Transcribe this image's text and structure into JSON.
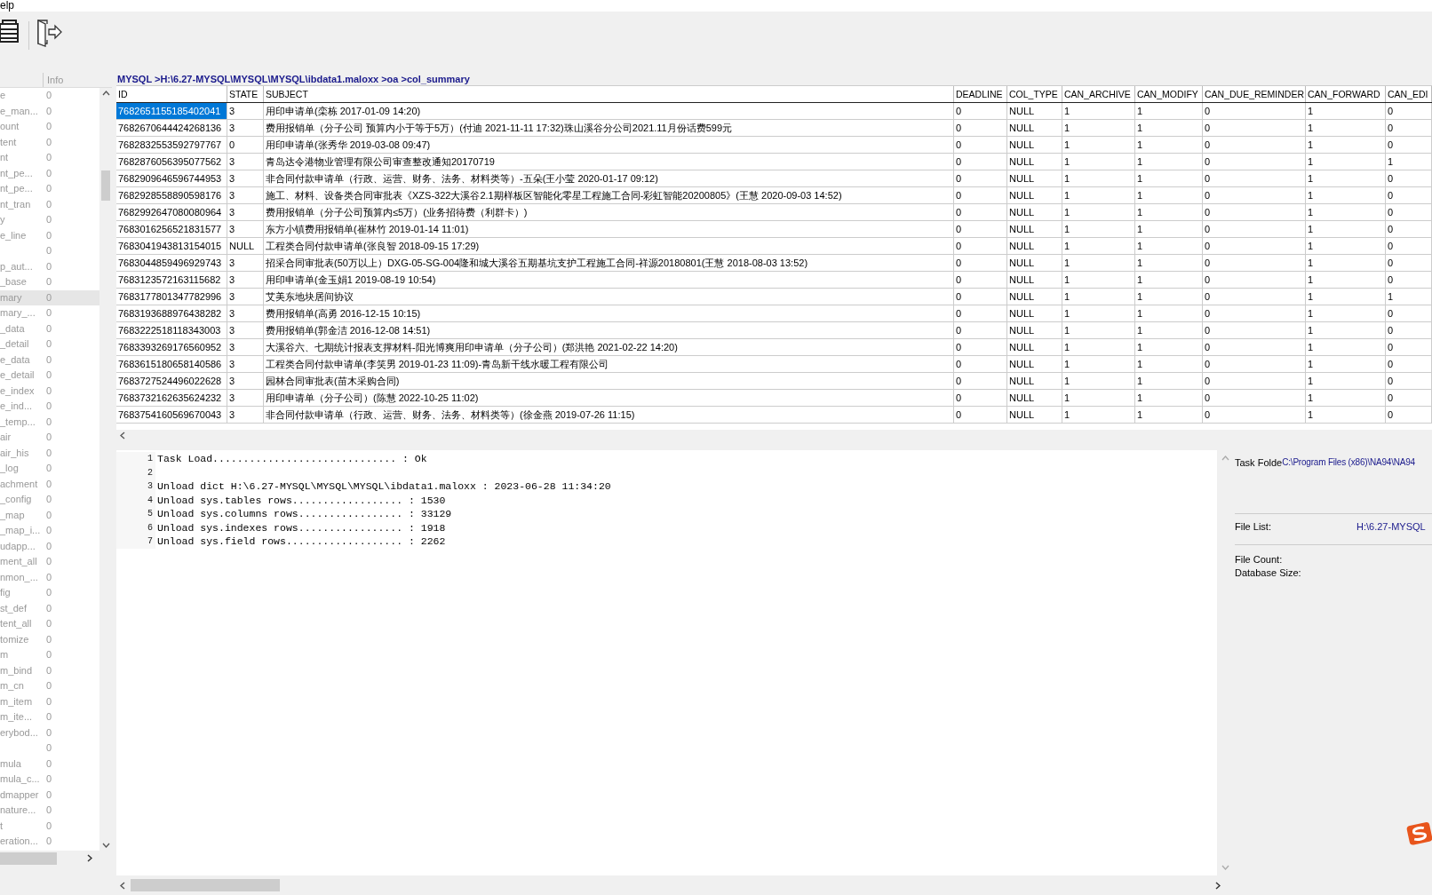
{
  "menu": {
    "items": [
      "elp"
    ]
  },
  "sidebar": {
    "header": "Info",
    "items": [
      {
        "name": "e",
        "info": "0",
        "selected": false
      },
      {
        "name": "e_man...",
        "info": "0",
        "selected": false
      },
      {
        "name": "ount",
        "info": "0",
        "selected": false
      },
      {
        "name": "tent",
        "info": "0",
        "selected": false
      },
      {
        "name": "nt",
        "info": "0",
        "selected": false
      },
      {
        "name": "nt_pe...",
        "info": "0",
        "selected": false
      },
      {
        "name": "nt_pe...",
        "info": "0",
        "selected": false
      },
      {
        "name": "nt_tran",
        "info": "0",
        "selected": false
      },
      {
        "name": "y",
        "info": "0",
        "selected": false
      },
      {
        "name": "e_line",
        "info": "0",
        "selected": false
      },
      {
        "info": "0",
        "selected": false
      },
      {
        "name": "p_aut...",
        "info": "0",
        "selected": false
      },
      {
        "name": "_base",
        "info": "0",
        "selected": false
      },
      {
        "name": "mary",
        "info": "0",
        "selected": true
      },
      {
        "name": "mary_...",
        "info": "0",
        "selected": false
      },
      {
        "name": "_data",
        "info": "0",
        "selected": false
      },
      {
        "name": "_detail",
        "info": "0",
        "selected": false
      },
      {
        "name": "e_data",
        "info": "0",
        "selected": false
      },
      {
        "name": "e_detail",
        "info": "0",
        "selected": false
      },
      {
        "name": "e_index",
        "info": "0",
        "selected": false
      },
      {
        "name": "e_ind...",
        "info": "0",
        "selected": false
      },
      {
        "name": "_temp...",
        "info": "0",
        "selected": false
      },
      {
        "name": "air",
        "info": "0",
        "selected": false
      },
      {
        "name": "air_his",
        "info": "0",
        "selected": false
      },
      {
        "name": "_log",
        "info": "0",
        "selected": false
      },
      {
        "name": "achment",
        "info": "0",
        "selected": false
      },
      {
        "name": "_config",
        "info": "0",
        "selected": false
      },
      {
        "name": "_map",
        "info": "0",
        "selected": false
      },
      {
        "name": "_map_i...",
        "info": "0",
        "selected": false
      },
      {
        "name": "udapp...",
        "info": "0",
        "selected": false
      },
      {
        "name": "ment_all",
        "info": "0",
        "selected": false
      },
      {
        "name": "nmon_...",
        "info": "0",
        "selected": false
      },
      {
        "name": "fig",
        "info": "0",
        "selected": false
      },
      {
        "name": "st_def",
        "info": "0",
        "selected": false
      },
      {
        "name": "tent_all",
        "info": "0",
        "selected": false
      },
      {
        "name": "tomize",
        "info": "0",
        "selected": false
      },
      {
        "name": "m",
        "info": "0",
        "selected": false
      },
      {
        "name": "m_bind",
        "info": "0",
        "selected": false
      },
      {
        "name": "m_cn",
        "info": "0",
        "selected": false
      },
      {
        "name": "m_item",
        "info": "0",
        "selected": false
      },
      {
        "name": "m_ite...",
        "info": "0",
        "selected": false
      },
      {
        "name": "erybod...",
        "info": "0",
        "selected": false
      },
      {
        "info": "0",
        "selected": false
      },
      {
        "name": "mula",
        "info": "0",
        "selected": false
      },
      {
        "name": "mula_c...",
        "info": "0",
        "selected": false
      },
      {
        "name": "dmapper",
        "info": "0",
        "selected": false
      },
      {
        "name": "nature...",
        "info": "0",
        "selected": false
      },
      {
        "name": "t",
        "info": "0",
        "selected": false
      },
      {
        "name": "eration...",
        "info": "0",
        "selected": false
      }
    ]
  },
  "table": {
    "path": "MYSQL >H:\\6.27-MYSQL\\MYSQL\\MYSQL\\ibdata1.maloxx >oa >col_summary",
    "columns": [
      "ID",
      "STATE",
      "SUBJECT",
      "DEADLINE",
      "COL_TYPE",
      "CAN_ARCHIVE",
      "CAN_MODIFY",
      "CAN_DUE_REMINDER",
      "CAN_FORWARD",
      "CAN_EDI"
    ],
    "rows": [
      {
        "selected": true,
        "cells": [
          "7682651155185402041",
          "3",
          "用印申请单(栾栋 2017-01-09 14:20)",
          "0",
          "NULL",
          "1",
          "1",
          "0",
          "1",
          "0"
        ]
      },
      {
        "selected": false,
        "cells": [
          "7682670644424268136",
          "3",
          "费用报销单（分子公司 预算内小于等于5万）(付迪 2021-11-11 17:32)珠山溪谷分公司2021.11月份话费599元",
          "0",
          "NULL",
          "1",
          "1",
          "0",
          "1",
          "0"
        ]
      },
      {
        "selected": false,
        "cells": [
          "7682832553592797767",
          "0",
          "用印申请单(张秀华 2019-03-08 09:47)",
          "0",
          "NULL",
          "1",
          "1",
          "0",
          "1",
          "0"
        ]
      },
      {
        "selected": false,
        "cells": [
          "7682876056395077562",
          "3",
          "青岛达令港物业管理有限公司审查整改通知20170719",
          "0",
          "NULL",
          "1",
          "1",
          "0",
          "1",
          "1"
        ]
      },
      {
        "selected": false,
        "cells": [
          "7682909646596744953",
          "3",
          "非合同付款申请单（行政、运营、财务、法务、材料类等）-五朵(王小莹 2020-01-17 09:12)",
          "0",
          "NULL",
          "1",
          "1",
          "0",
          "1",
          "0"
        ]
      },
      {
        "selected": false,
        "cells": [
          "7682928558890598176",
          "3",
          "施工、材料、设备类合同审批表《XZS-322大溪谷2.1期样板区智能化零星工程施工合同-彩虹智能20200805》(王慧 2020-09-03 14:52)",
          "0",
          "NULL",
          "1",
          "1",
          "0",
          "1",
          "0"
        ]
      },
      {
        "selected": false,
        "cells": [
          "7682992647080080964",
          "3",
          "费用报销单（分子公司预算内≤5万）(业务招待费（利群卡）)",
          "0",
          "NULL",
          "1",
          "1",
          "0",
          "1",
          "0"
        ]
      },
      {
        "selected": false,
        "cells": [
          "7683016256521831577",
          "3",
          "东方小镇费用报销单(崔林竹 2019-01-14 11:01)",
          "0",
          "NULL",
          "1",
          "1",
          "0",
          "1",
          "0"
        ]
      },
      {
        "selected": false,
        "cells": [
          "7683041943813154015",
          "NULL",
          "工程类合同付款申请单(张良智 2018-09-15 17:29)",
          "0",
          "NULL",
          "1",
          "1",
          "0",
          "1",
          "0"
        ]
      },
      {
        "selected": false,
        "cells": [
          "7683044859496929743",
          "3",
          "招采合同审批表(50万以上）DXG-05-SG-004隆和城大溪谷五期基坑支护工程施工合同-祥源20180801(王慧 2018-08-03 13:52)",
          "0",
          "NULL",
          "1",
          "1",
          "0",
          "1",
          "0"
        ]
      },
      {
        "selected": false,
        "cells": [
          "7683123572163115682",
          "3",
          "用印申请单(金玉娟1 2019-08-19 10:54)",
          "0",
          "NULL",
          "1",
          "1",
          "0",
          "1",
          "0"
        ]
      },
      {
        "selected": false,
        "cells": [
          "7683177801347782996",
          "3",
          "艾美东地块居间协议",
          "0",
          "NULL",
          "1",
          "1",
          "0",
          "1",
          "1"
        ]
      },
      {
        "selected": false,
        "cells": [
          "7683193688976438282",
          "3",
          "费用报销单(高勇 2016-12-15 10:15)",
          "0",
          "NULL",
          "1",
          "1",
          "0",
          "1",
          "0"
        ]
      },
      {
        "selected": false,
        "cells": [
          "7683222518118343003",
          "3",
          "费用报销单(郭金洁 2016-12-08 14:51)",
          "0",
          "NULL",
          "1",
          "1",
          "0",
          "1",
          "0"
        ]
      },
      {
        "selected": false,
        "cells": [
          "7683393269176560952",
          "3",
          "大溪谷六、七期统计报表支撑材料-阳光博爽用印申请单（分子公司）(郑洪艳 2021-02-22 14:20)",
          "0",
          "NULL",
          "1",
          "1",
          "0",
          "1",
          "0"
        ]
      },
      {
        "selected": false,
        "cells": [
          "7683615180658140586",
          "3",
          "工程类合同付款申请单(李笑男 2019-01-23 11:09)-青岛新干线水暖工程有限公司",
          "0",
          "NULL",
          "1",
          "1",
          "0",
          "1",
          "0"
        ]
      },
      {
        "selected": false,
        "cells": [
          "7683727524496022628",
          "3",
          "园林合同审批表(苗木采购合同)",
          "0",
          "NULL",
          "1",
          "1",
          "0",
          "1",
          "0"
        ]
      },
      {
        "selected": false,
        "cells": [
          "7683732162635624232",
          "3",
          "用印申请单（分子公司）(陈慧 2022-10-25 11:02)",
          "0",
          "NULL",
          "1",
          "1",
          "0",
          "1",
          "0"
        ]
      },
      {
        "selected": false,
        "cells": [
          "7683754160569670043",
          "3",
          "非合同付款申请单（行政、运营、财务、法务、材料类等）(徐金燕 2019-07-26 11:15)",
          "0",
          "NULL",
          "1",
          "1",
          "0",
          "1",
          "0"
        ]
      }
    ]
  },
  "log": {
    "lines": [
      {
        "number": "1",
        "text": "Task Load.............................. : Ok"
      },
      {
        "number": "2"
      },
      {
        "number": "3",
        "text": "Unload dict H:\\6.27-MYSQL\\MYSQL\\MYSQL\\ibdata1.maloxx : 2023-06-28 11:34:20"
      },
      {
        "number": "4",
        "text": "Unload sys.tables rows.................. : 1530"
      },
      {
        "number": "5",
        "text": "Unload sys.columns rows................. : 33129"
      },
      {
        "number": "6",
        "text": "Unload sys.indexes rows................. : 1918"
      },
      {
        "number": "7",
        "text": "Unload sys.field rows................... : 2262"
      }
    ]
  },
  "info_panel": {
    "task_folder": {
      "label": "Task Folde",
      "value": "C:\\Program Files (x86)\\NA94\\NA94"
    },
    "file_list": {
      "label": "File List:",
      "value": "H:\\6.27-MYSQL"
    },
    "file_count": {
      "label": "File Count:"
    },
    "database_size": {
      "label": "Database Size:"
    }
  }
}
